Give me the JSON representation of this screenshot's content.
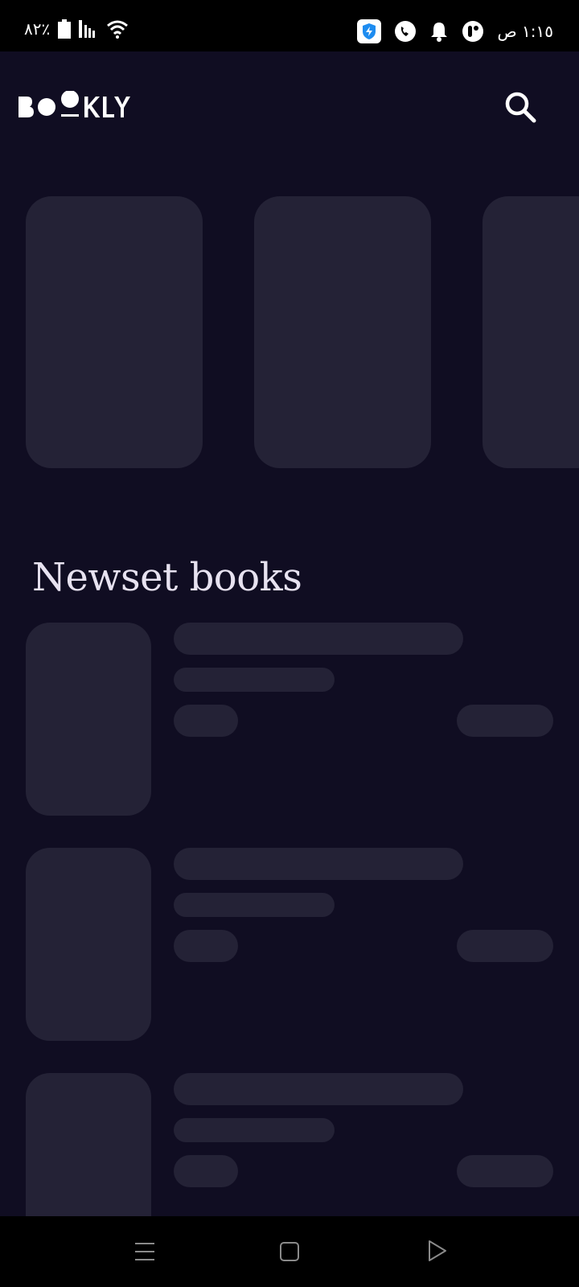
{
  "status_bar": {
    "battery_percent": "٨٢٪",
    "time": "١:١٥ ص",
    "icons": [
      "battery-icon",
      "signal-icon",
      "wifi-icon",
      "security-app-icon",
      "phone-app-icon",
      "notification-bell-icon",
      "app-notification-icon"
    ]
  },
  "app_bar": {
    "logo_text": "BOOKLY",
    "search_icon": "search-icon"
  },
  "featured": {
    "cards": 3,
    "state": "loading"
  },
  "newest": {
    "title": "Newset books",
    "items": 3,
    "state": "loading"
  },
  "nav_bar": {
    "icons": [
      "recents-icon",
      "home-icon",
      "back-icon"
    ]
  },
  "colors": {
    "background": "#100d22",
    "skeleton": "#242236",
    "title": "#e7e2f0",
    "system_bars": "#000000"
  }
}
